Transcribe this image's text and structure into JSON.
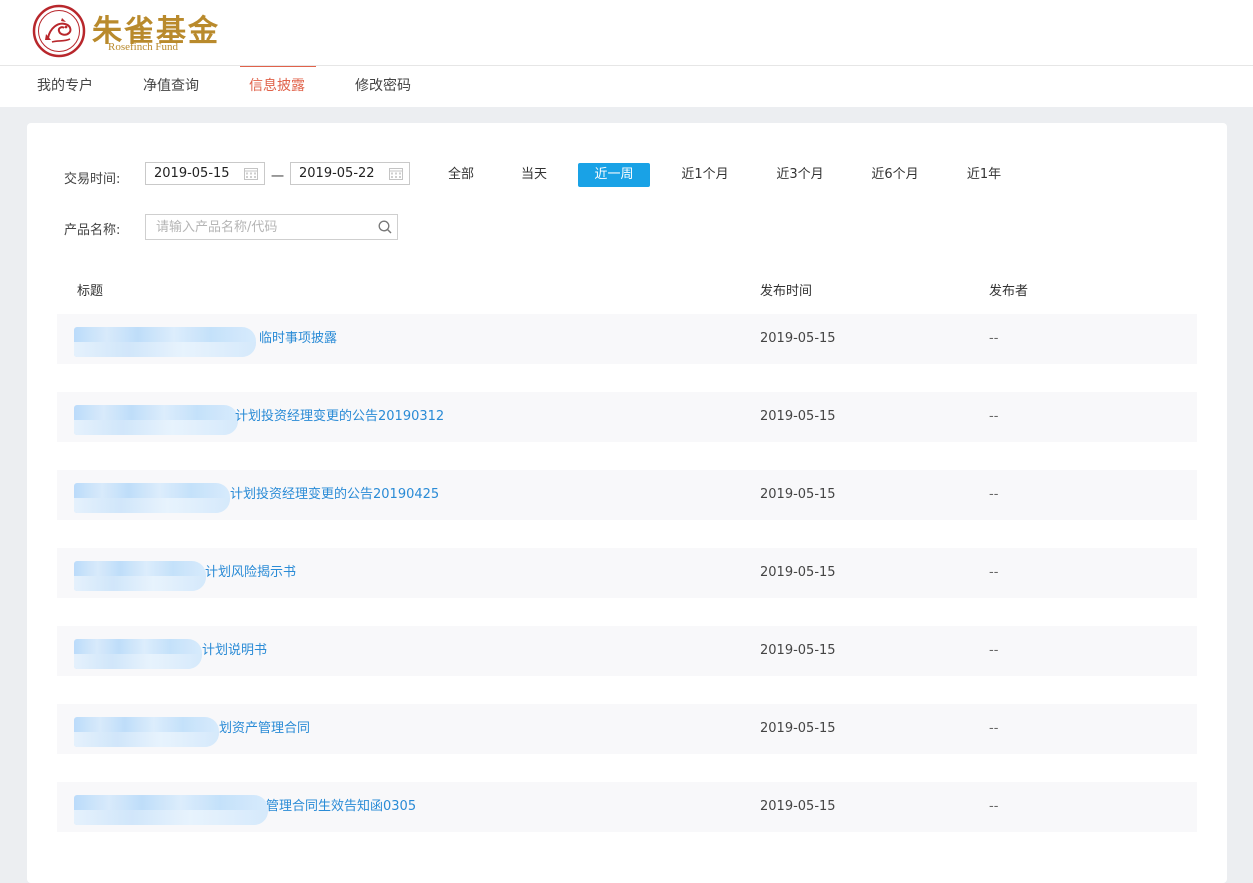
{
  "brand": {
    "name_cn": "朱雀基金",
    "name_en": "Rosefinch Fund",
    "accent_color": "#b98a2c"
  },
  "nav": {
    "items": [
      {
        "label": "我的专户"
      },
      {
        "label": "净值查询"
      },
      {
        "label": "信息披露",
        "active": true
      },
      {
        "label": "修改密码"
      }
    ],
    "active_color": "#e0624a"
  },
  "filters": {
    "trade_time_label": "交易时间:",
    "start_date": "2019-05-15",
    "end_date": "2019-05-22",
    "separator": "一",
    "ranges": [
      {
        "label": "全部"
      },
      {
        "label": "当天"
      },
      {
        "label": "近一周",
        "active": true
      },
      {
        "label": "近1个月"
      },
      {
        "label": "近3个月"
      },
      {
        "label": "近6个月"
      },
      {
        "label": "近1年"
      }
    ],
    "product_name_label": "产品名称:",
    "product_placeholder": "请输入产品名称/代码",
    "active_color": "#19a2e6"
  },
  "table": {
    "headers": {
      "title": "标题",
      "time": "发布时间",
      "publisher": "发布者"
    },
    "rows": [
      {
        "title": "临时事项披露",
        "date": "2019-05-15",
        "publisher": "--"
      },
      {
        "title": "计划投资经理变更的公告20190312",
        "date": "2019-05-15",
        "publisher": "--"
      },
      {
        "title": "计划投资经理变更的公告20190425",
        "date": "2019-05-15",
        "publisher": "--"
      },
      {
        "title": "计划风险揭示书",
        "date": "2019-05-15",
        "publisher": "--"
      },
      {
        "title": "计划说明书",
        "date": "2019-05-15",
        "publisher": "--"
      },
      {
        "title": "划资产管理合同",
        "date": "2019-05-15",
        "publisher": "--"
      },
      {
        "title": "管理合同生效告知函0305",
        "date": "2019-05-15",
        "publisher": "--"
      }
    ],
    "link_color": "#2a8bd6"
  }
}
